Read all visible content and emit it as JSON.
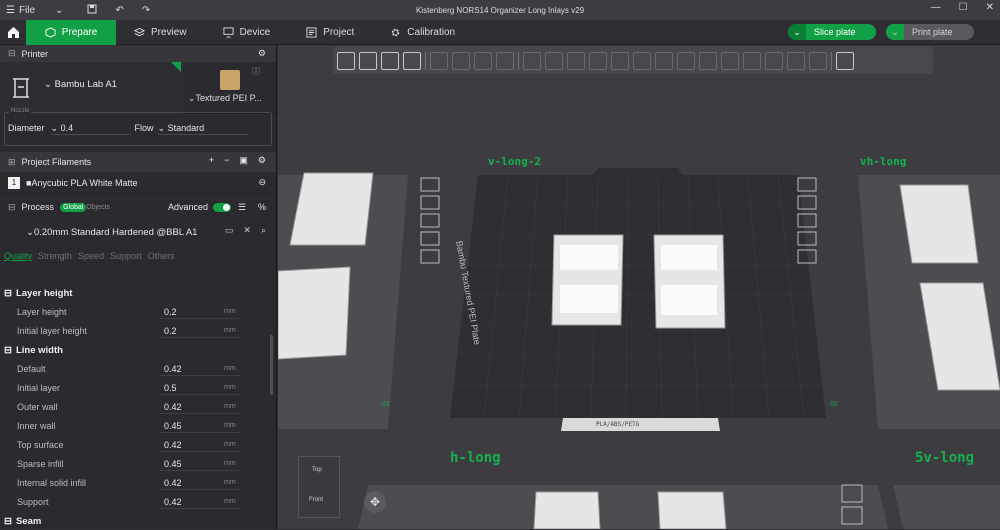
{
  "app": {
    "title": "Kistenberg NORS14 Organizer Long Inlays v29",
    "menu": {
      "file_label": "File"
    }
  },
  "tabs": [
    {
      "label": "Prepare",
      "icon": "cube-icon",
      "active": true
    },
    {
      "label": "Preview",
      "icon": "layers-icon",
      "active": false
    },
    {
      "label": "Device",
      "icon": "device-icon",
      "active": false
    },
    {
      "label": "Project",
      "icon": "project-icon",
      "active": false
    },
    {
      "label": "Calibration",
      "icon": "calibration-icon",
      "active": false
    }
  ],
  "actions": {
    "slice_label": "Slice plate",
    "print_label": "Print plate"
  },
  "printer": {
    "section_label": "Printer",
    "name": "Bambu Lab A1",
    "plate_type": "Textured PEI P...",
    "nozzle_legend": "Nozzle",
    "diameter_label": "Diameter",
    "diameter_value": "0.4",
    "flow_label": "Flow",
    "flow_value": "Standard"
  },
  "filaments": {
    "section_label": "Project Filaments",
    "items": [
      {
        "index": "1",
        "name": "Anycubic PLA White Matte"
      }
    ]
  },
  "process": {
    "section_label": "Process",
    "global_label": "Global",
    "objects_label": "Objects",
    "advanced_label": "Advanced",
    "preset": "0.20mm Standard Hardened @BBL A1",
    "tabs": [
      "Quality",
      "Strength",
      "Speed",
      "Support",
      "Others"
    ],
    "groups": [
      {
        "name": "Layer height",
        "params": [
          {
            "label": "Layer height",
            "value": "0.2",
            "unit": "mm"
          },
          {
            "label": "Initial layer height",
            "value": "0.2",
            "unit": "mm"
          }
        ]
      },
      {
        "name": "Line width",
        "params": [
          {
            "label": "Default",
            "value": "0.42",
            "unit": "mm"
          },
          {
            "label": "Initial layer",
            "value": "0.5",
            "unit": "mm"
          },
          {
            "label": "Outer wall",
            "value": "0.42",
            "unit": "mm"
          },
          {
            "label": "Inner wall",
            "value": "0.45",
            "unit": "mm"
          },
          {
            "label": "Top surface",
            "value": "0.42",
            "unit": "mm"
          },
          {
            "label": "Sparse infill",
            "value": "0.45",
            "unit": "mm"
          },
          {
            "label": "Internal solid infill",
            "value": "0.42",
            "unit": "mm"
          },
          {
            "label": "Support",
            "value": "0.42",
            "unit": "mm"
          }
        ]
      },
      {
        "name": "Seam",
        "params": []
      }
    ]
  },
  "viewport": {
    "plates": [
      {
        "label": "v-long-2"
      },
      {
        "label": "vh-long"
      },
      {
        "label": "h-long"
      },
      {
        "label": "5v-long"
      }
    ],
    "plate_numbers": [
      "01",
      "02"
    ],
    "bed_label": "Bambu Textured PEI Plate",
    "bed_sticker": "PLA/ABS/PETG",
    "view_cube": {
      "top": "Top",
      "front": "Front"
    }
  },
  "colors": {
    "accent": "#11a046",
    "panel": "#2b2b2f",
    "viewport": "#3d3d41"
  }
}
